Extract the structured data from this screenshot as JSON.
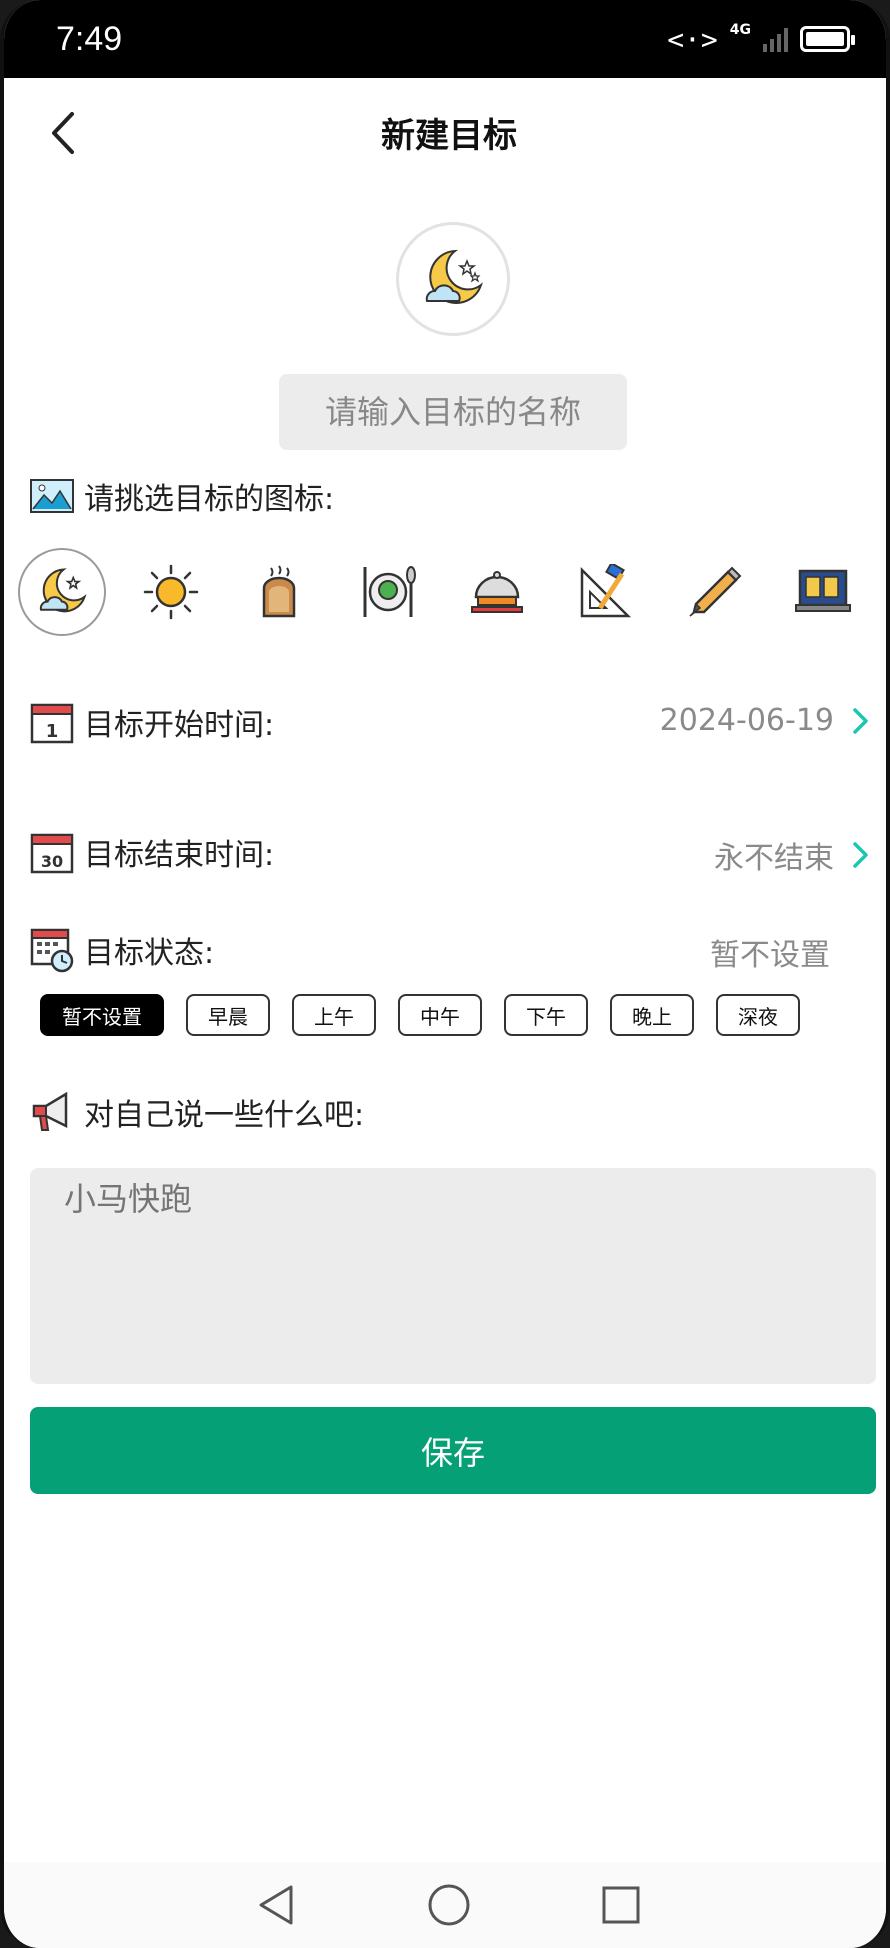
{
  "status": {
    "time": "7:49",
    "network": "<·>",
    "net_type": "4G"
  },
  "header": {
    "title": "新建目标"
  },
  "name_input": {
    "placeholder": "请输入目标的名称"
  },
  "icon_section": {
    "label": "请挑选目标的图标:",
    "icons": [
      "moon-night-icon",
      "sun-icon",
      "toast-icon",
      "dinner-plate-icon",
      "food-cloche-icon",
      "ruler-pencil-icon",
      "marker-pen-icon",
      "laptop-icon"
    ],
    "selected_index": 0
  },
  "start_time": {
    "label": "目标开始时间:",
    "value": "2024-06-19"
  },
  "end_time": {
    "label": "目标结束时间:",
    "value": "永不结束"
  },
  "status_row": {
    "label": "目标状态:",
    "value": "暂不设置",
    "options": [
      "暂不设置",
      "早晨",
      "上午",
      "中午",
      "下午",
      "晚上",
      "深夜"
    ],
    "selected_index": 0
  },
  "note": {
    "label": "对自己说一些什么吧:",
    "placeholder": "小马快跑"
  },
  "save_button": {
    "label": "保存"
  },
  "colors": {
    "primary": "#05a075",
    "chevron": "#1cc6b0",
    "input_bg": "#ececec"
  }
}
